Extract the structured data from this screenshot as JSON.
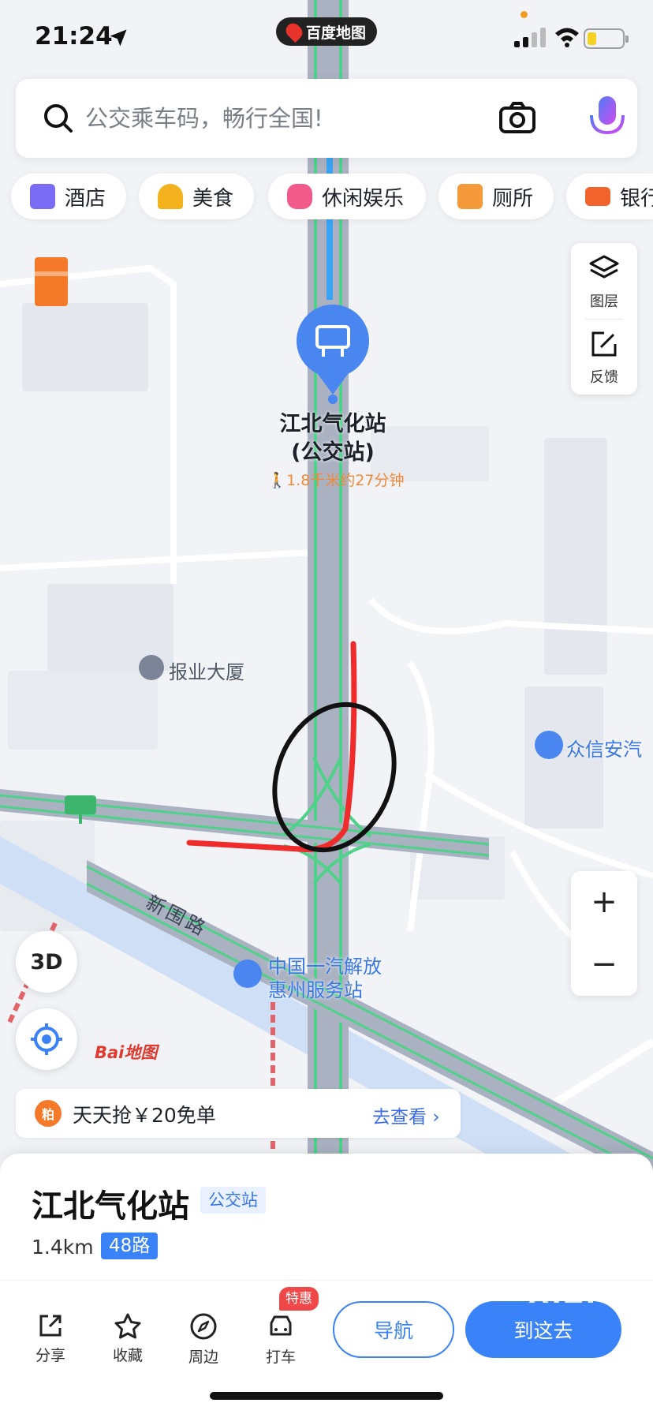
{
  "status": {
    "time": "21:24",
    "app_badge": "百度地图"
  },
  "search": {
    "placeholder": "公交乘车码，畅行全国!"
  },
  "categories": [
    {
      "label": "酒店",
      "icon": "hotel-icon",
      "color": "#7b6cf6"
    },
    {
      "label": "美食",
      "icon": "food-icon",
      "color": "#f5b21f"
    },
    {
      "label": "休闲娱乐",
      "icon": "gamepad-icon",
      "color": "#f25a8c"
    },
    {
      "label": "厕所",
      "icon": "toilet-icon",
      "color": "#f59a3a"
    },
    {
      "label": "银行",
      "icon": "bank-card-icon",
      "color": "#f2622c"
    }
  ],
  "map_controls": {
    "layers_label": "图层",
    "feedback_label": "反馈",
    "three_d_label": "3D"
  },
  "map": {
    "marker_name": "江北气化站",
    "marker_sub": "(公交站)",
    "walk_info": "1.8千米约27分钟",
    "pois": [
      {
        "label": "报业大厦"
      },
      {
        "label": "众信安汽"
      },
      {
        "label": "中国一汽解放"
      },
      {
        "label": "惠州服务站"
      }
    ],
    "road_label": "新围路",
    "brand_logo": "Bai地图"
  },
  "promo": {
    "icon_text": "粕",
    "text": "天天抢￥20免单",
    "link": "去查看"
  },
  "place": {
    "title": "江北气化站",
    "type": "公交站",
    "distance": "1.4km",
    "route": "48路"
  },
  "actions": {
    "share": "分享",
    "favorite": "收藏",
    "nearby": "周边",
    "taxi": "打车",
    "taxi_tag": "特惠",
    "navigate": "导航",
    "go_here": "到这去"
  },
  "watermark": "XIZI"
}
